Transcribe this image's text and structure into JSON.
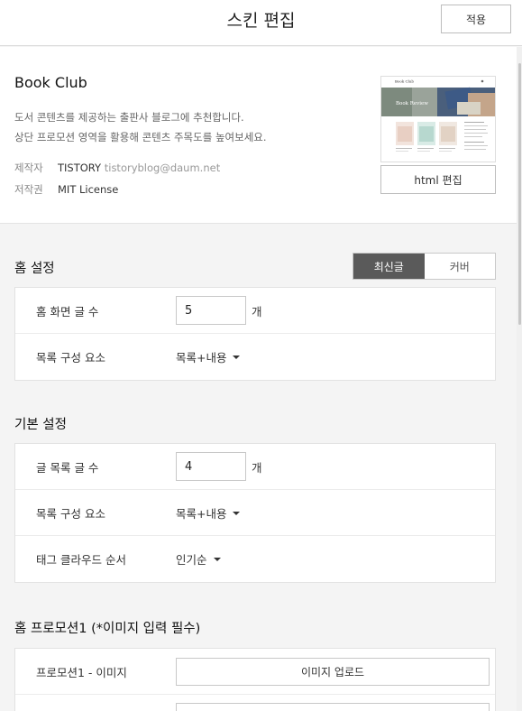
{
  "header": {
    "title": "스킨 편집",
    "apply_label": "적용"
  },
  "skin": {
    "name": "Book Club",
    "desc_line1": "도서 콘텐츠를 제공하는 출판사 블로그에 추천합니다.",
    "desc_line2": "상단 프로모션 영역을 활용해 콘텐츠 주목도를 높여보세요.",
    "maker_label": "제작자",
    "maker_name": "TISTORY",
    "maker_email": "tistoryblog@daum.net",
    "license_label": "저작권",
    "license_value": "MIT License",
    "html_edit_label": "html 편집",
    "thumbnail": {
      "site_title": "Book Club",
      "banner_text": "Book Review"
    }
  },
  "home_settings": {
    "title": "홈 설정",
    "tabs": [
      "최신글",
      "커버"
    ],
    "active_tab": "최신글",
    "post_count_label": "홈 화면 글 수",
    "post_count_value": "5",
    "unit": "개",
    "list_element_label": "목록 구성 요소",
    "list_element_value": "목록+내용"
  },
  "basic_settings": {
    "title": "기본 설정",
    "post_count_label": "글 목록 글 수",
    "post_count_value": "4",
    "unit": "개",
    "list_element_label": "목록 구성 요소",
    "list_element_value": "목록+내용",
    "tag_order_label": "태그 클라우드 순서",
    "tag_order_value": "인기순"
  },
  "promotion1": {
    "title": "홈 프로모션1 (*이미지 입력 필수)",
    "image_label": "프로모션1 - 이미지",
    "upload_label": "이미지 업로드"
  }
}
